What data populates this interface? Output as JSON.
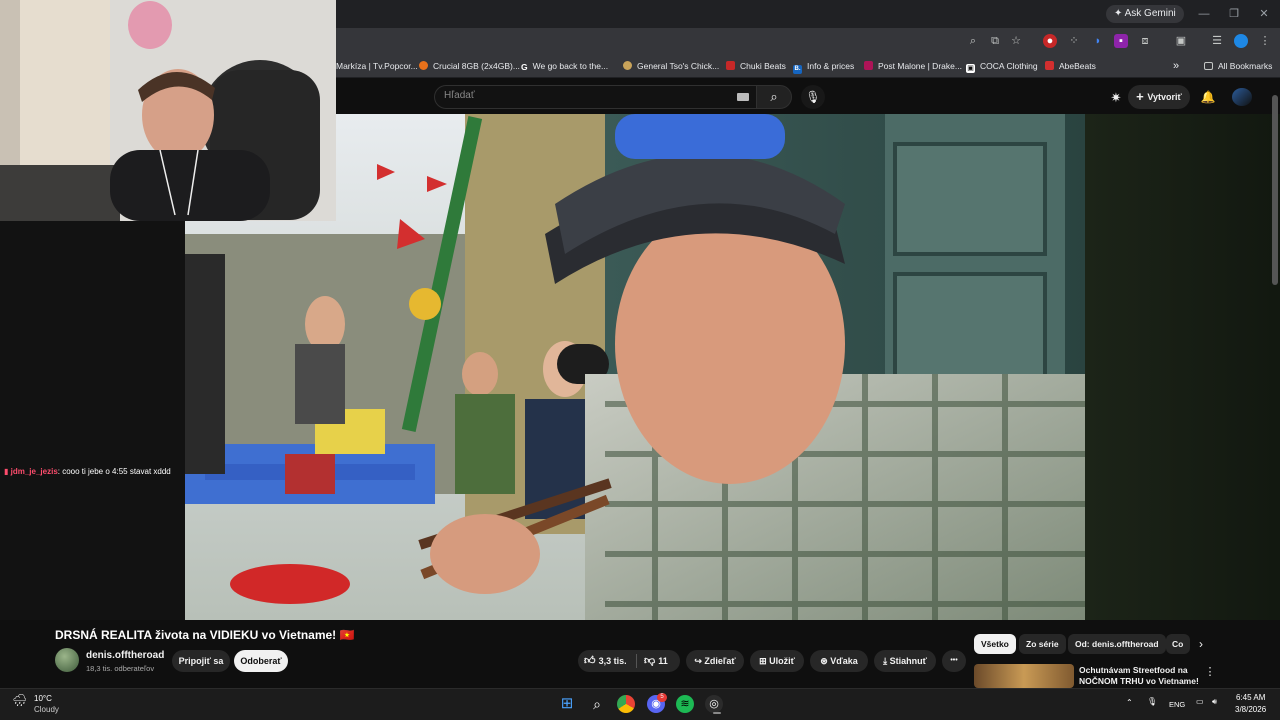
{
  "browser": {
    "ask_gemini": "Ask Gemini",
    "bookmarks": [
      {
        "label": "Markíza | Tv.Popcor...",
        "color": "#35363a"
      },
      {
        "label": "Crucial 8GB (2x4GB)...",
        "color": "#e8711a"
      },
      {
        "label": "We go back to the...",
        "color": "#4285f4"
      },
      {
        "label": "General Tso's Chick...",
        "color": "#c8a35a"
      },
      {
        "label": "Chuki Beats",
        "color": "#c62828"
      },
      {
        "label": "Info & prices",
        "color": "#1565c0"
      },
      {
        "label": "Post Malone | Drake...",
        "color": "#ad1457"
      },
      {
        "label": "COCA Clothing",
        "color": "#111111"
      },
      {
        "label": "AbeBeats",
        "color": "#d32f2f"
      }
    ],
    "bookmark_fav_letters": [
      "",
      "",
      "G",
      "",
      "",
      "B.",
      "",
      "▣",
      ""
    ],
    "more_bookmarks": "»",
    "all_bookmarks": "All Bookmarks"
  },
  "youtube": {
    "search_placeholder": "Hľadať",
    "create_label": "Vytvoriť",
    "video_title": "DRSNÁ REALITA života na VIDIEKU vo Vietname! 🇻🇳",
    "channel_name": "denis.offtheroad",
    "subscribers": "18,3 tis. odberateľov",
    "join_label": "Pripojiť sa",
    "subscribe_label": "Odoberať",
    "likes": "3,3 tis.",
    "dislikes": "11",
    "share_label": "Zdieľať",
    "save_label": "Uložiť",
    "thanks_label": "Vďaka",
    "download_label": "Stiahnuť",
    "more_label": "•••",
    "chips": [
      "Všetko",
      "Zo série",
      "Od: denis.offtheroad",
      "Co"
    ],
    "rec_title": "Ochutnávam Streetfood na NOČNOM TRHU vo Vietname! ..."
  },
  "stream": {
    "chat_user": "jdm_je_jezis",
    "chat_text": ": cooo ti jebe o 4:55 stavat xddd"
  },
  "taskbar": {
    "weather_temp": "10°C",
    "weather_desc": "Cloudy",
    "language": "ENG",
    "time": "6:45 AM",
    "date": "3/8/2026",
    "discord_badge": "5"
  },
  "colors": {
    "chrome_dark": "#202124",
    "chrome_toolbar": "#35363a",
    "yt_bg": "#0f0f0f",
    "chat_user": "#ff4d6d"
  }
}
